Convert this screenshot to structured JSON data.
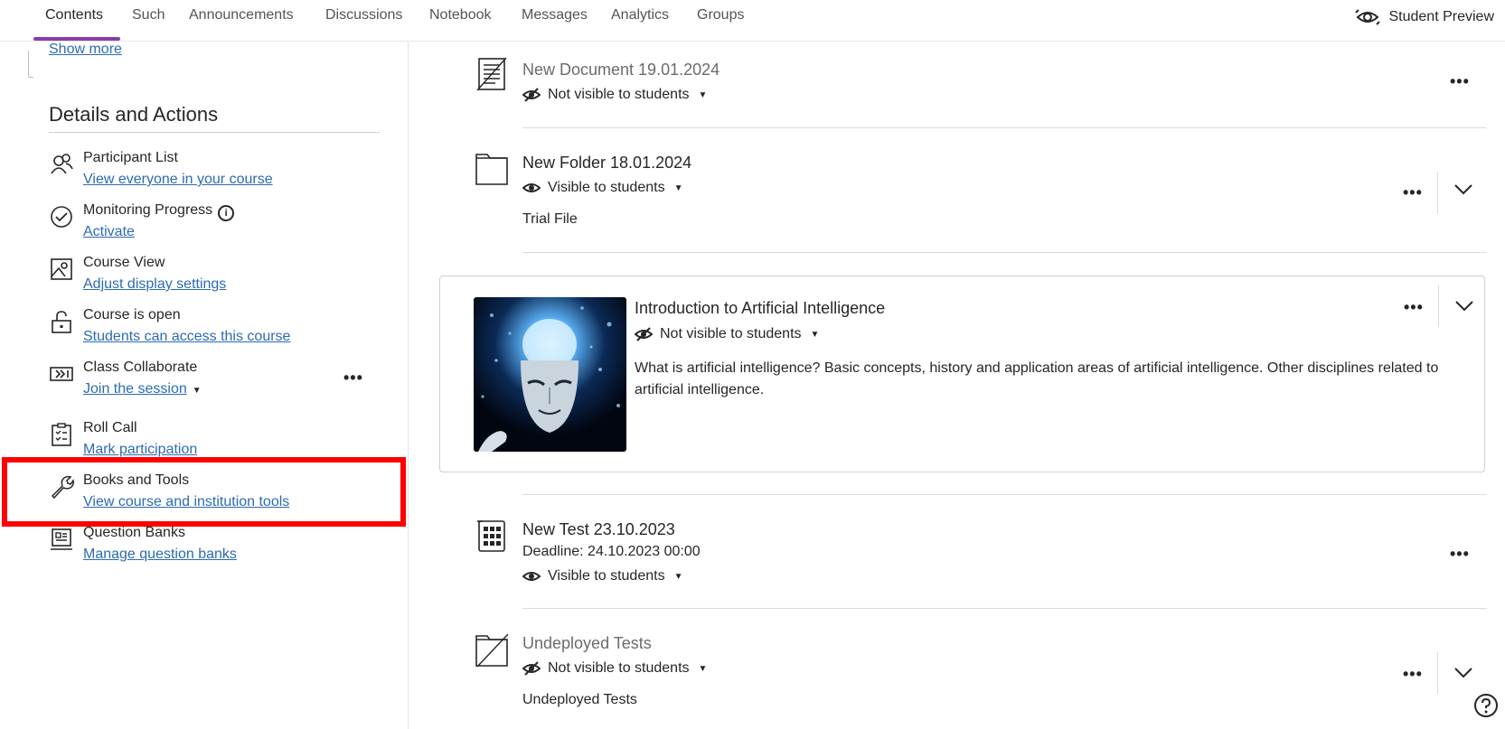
{
  "nav": {
    "tabs": [
      "Contents",
      "Such",
      "Announcements",
      "Discussions",
      "Notebook",
      "Messages",
      "Analytics",
      "Groups"
    ],
    "student_preview": "Student Preview"
  },
  "sidebar": {
    "show_more": "Show more",
    "details_title": "Details and Actions",
    "actions": [
      {
        "title": "Participant List",
        "link": "View everyone in your course",
        "icon": "participants-icon"
      },
      {
        "title": "Monitoring Progress",
        "link": "Activate",
        "icon": "check-circle-icon"
      },
      {
        "title": "Course View",
        "link": "Adjust display settings",
        "icon": "image-icon"
      },
      {
        "title": "Course is open",
        "link": "Students can access this course",
        "icon": "unlock-icon"
      },
      {
        "title": "Class Collaborate",
        "link": "Join the session",
        "icon": "video-icon"
      },
      {
        "title": "Roll Call",
        "link": "Mark participation",
        "icon": "clipboard-icon"
      },
      {
        "title": "Books and Tools",
        "link": "View course and institution tools",
        "icon": "wrench-icon"
      },
      {
        "title": "Question Banks",
        "link": "Manage question banks",
        "icon": "question-bank-icon"
      }
    ]
  },
  "content": {
    "items": [
      {
        "title": "New Document 19.01.2024",
        "visibility": "Not visible to students",
        "icon": "document-icon"
      },
      {
        "title": "New Folder 18.01.2024",
        "visibility": "Visible to students",
        "subtitle": "Trial File",
        "icon": "folder-icon"
      },
      {
        "title": "Introduction to Artificial Intelligence",
        "visibility": "Not visible to students",
        "description": "What is artificial intelligence? Basic concepts, history and application areas of artificial intelligence. Other disciplines related to artificial intelligence."
      },
      {
        "title": "New Test 23.10.2023",
        "deadline": "Deadline: 24.10.2023 00:00",
        "visibility": "Visible to students",
        "icon": "test-icon"
      },
      {
        "title": "Undeployed Tests",
        "visibility": "Not visible to students",
        "subtitle": "Undeployed Tests",
        "icon": "folder-hidden-icon"
      }
    ]
  },
  "colors": {
    "accent": "#8b3bac",
    "link": "#2b6bb3",
    "highlight": "#ff0000"
  }
}
